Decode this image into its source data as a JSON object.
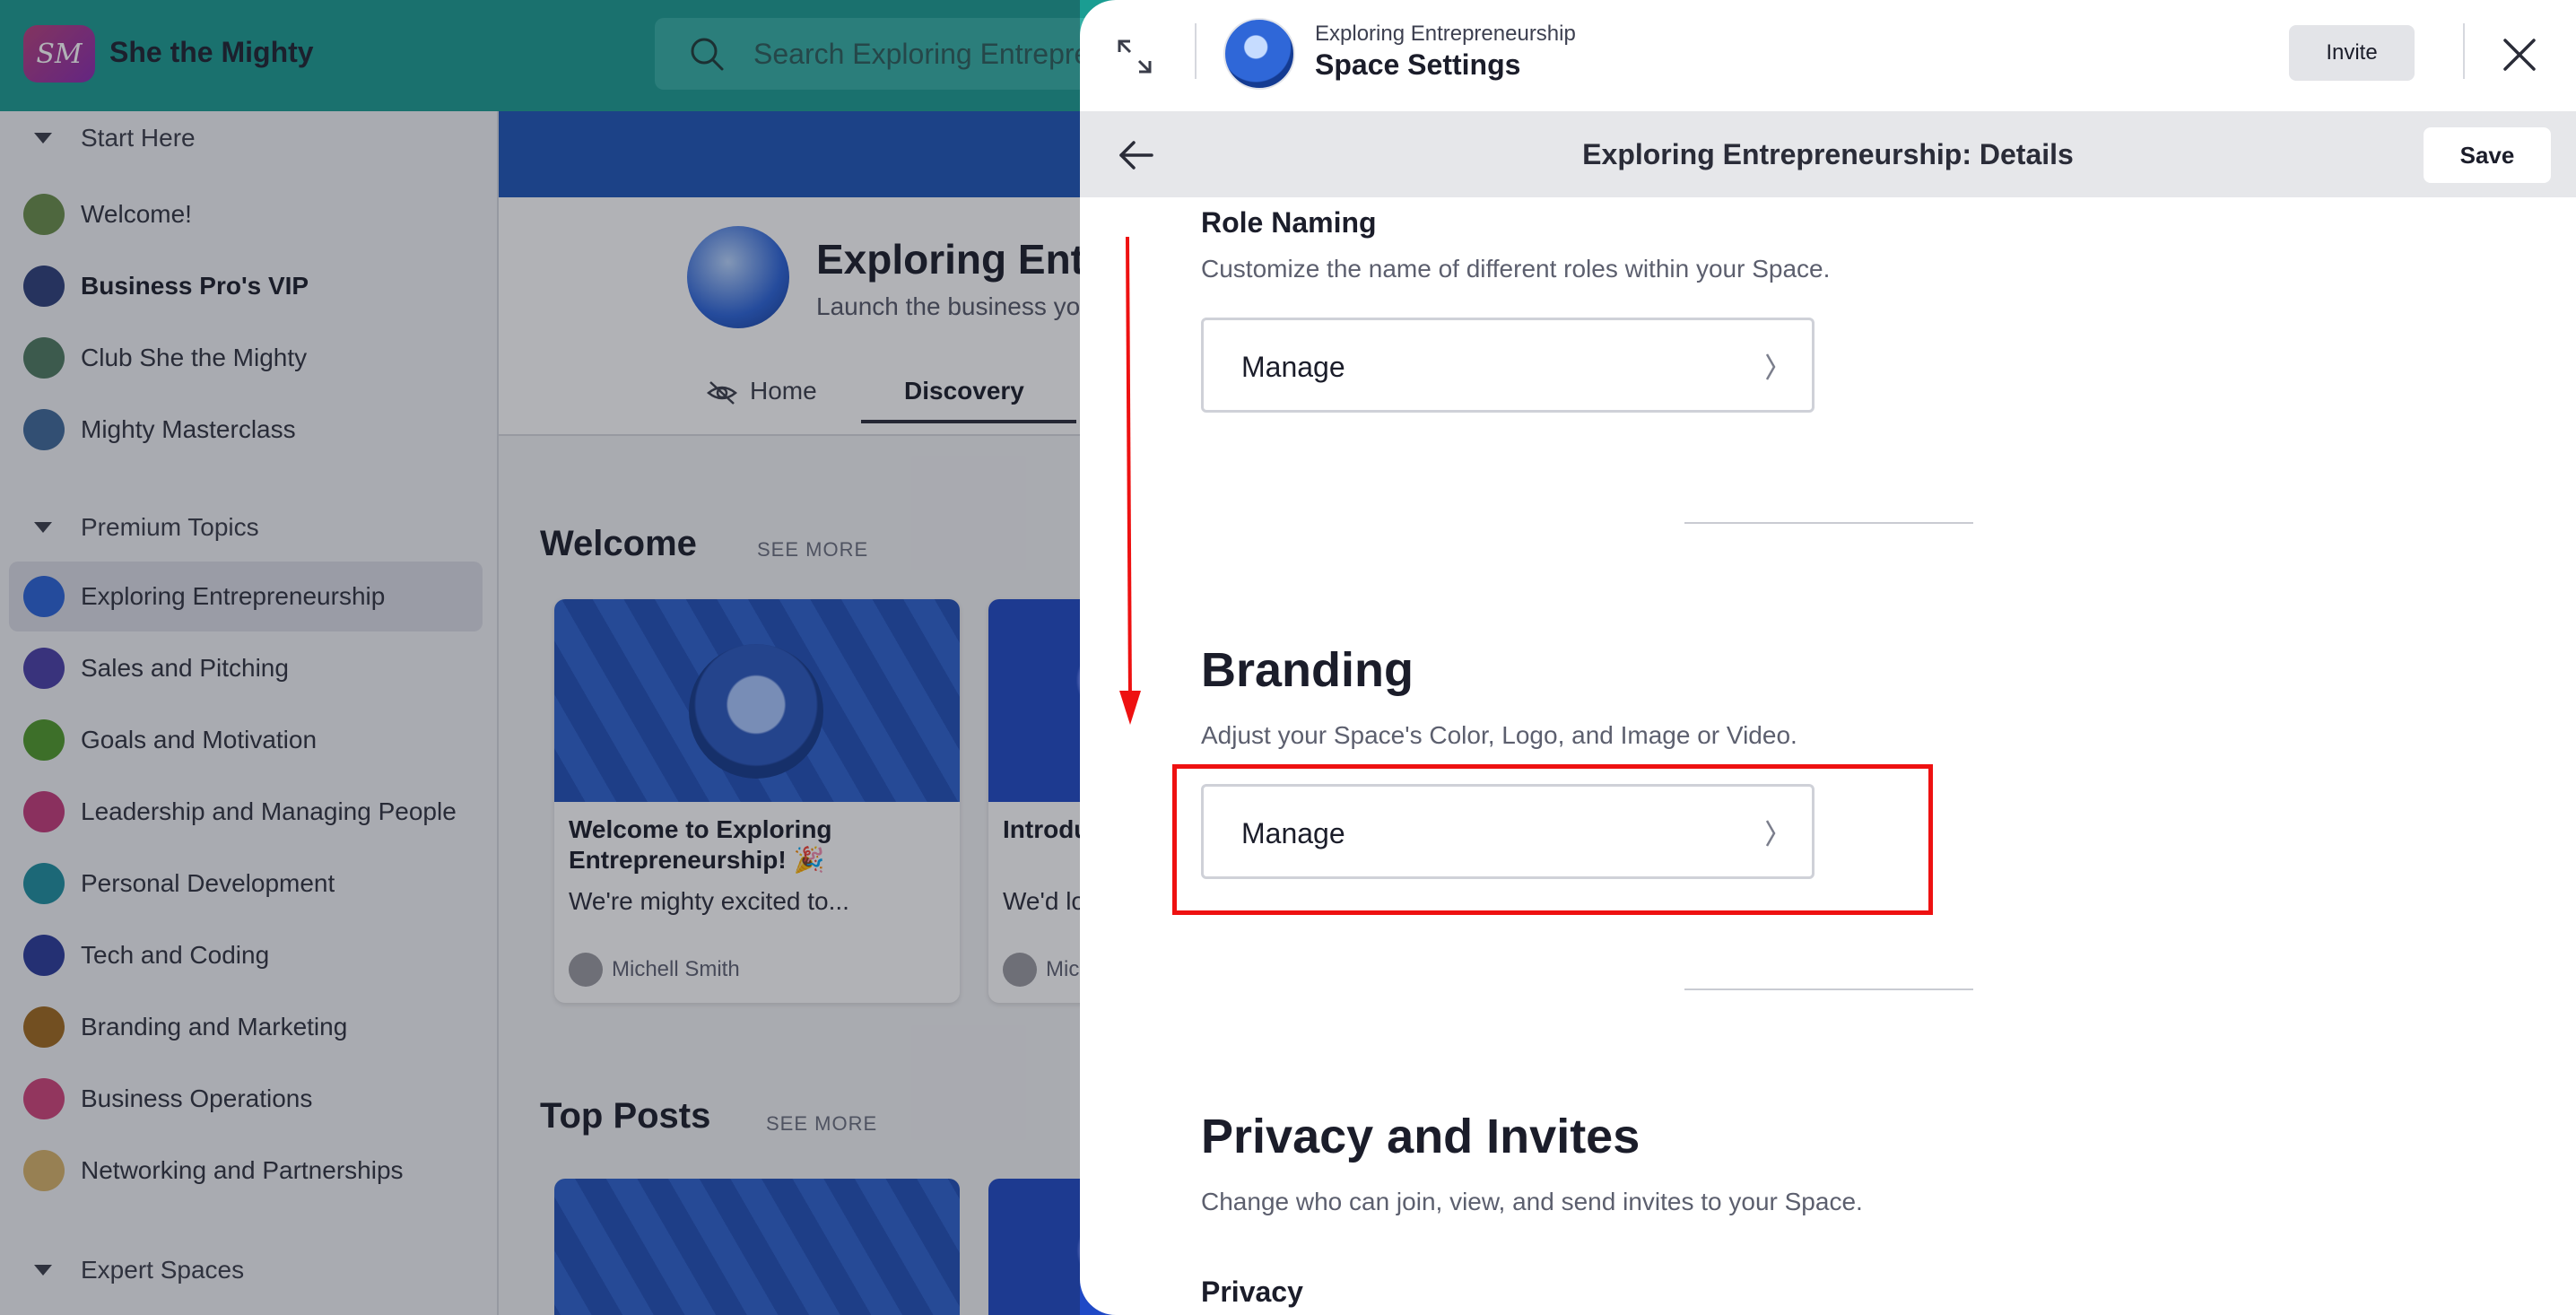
{
  "app": {
    "name": "She the Mighty",
    "logo_text": "SM",
    "search_placeholder": "Search Exploring Entrepre"
  },
  "sidebar": {
    "sections": [
      {
        "label": "Start Here"
      },
      {
        "label": "Premium Topics"
      },
      {
        "label": "Expert Spaces"
      }
    ],
    "items": [
      {
        "label": "Welcome!",
        "color": "#6a8d4a"
      },
      {
        "label": "Business Pro's VIP",
        "color": "#2c3f7a"
      },
      {
        "label": "Club She the Mighty",
        "color": "#4e7a60"
      },
      {
        "label": "Mighty Masterclass",
        "color": "#3f6a9a"
      },
      {
        "label": "Exploring Entrepreneurship",
        "color": "#2a63d8"
      },
      {
        "label": "Sales and Pitching",
        "color": "#4a3fa8"
      },
      {
        "label": "Goals and Motivation",
        "color": "#4f9a2a"
      },
      {
        "label": "Leadership and Managing People",
        "color": "#c43a7a"
      },
      {
        "label": "Personal Development",
        "color": "#1e8fa0"
      },
      {
        "label": "Tech and Coding",
        "color": "#2a3a9a"
      },
      {
        "label": "Branding and Marketing",
        "color": "#a06a1e"
      },
      {
        "label": "Business Operations",
        "color": "#d0447a"
      },
      {
        "label": "Networking and Partnerships",
        "color": "#d8b46a"
      }
    ]
  },
  "space": {
    "title": "Exploring Entr",
    "subtitle": "Launch the business yo",
    "tabs": [
      {
        "label": "Home"
      },
      {
        "label": "Discovery"
      }
    ],
    "welcome_heading": "Welcome",
    "top_posts_heading": "Top Posts",
    "see_more": "SEE MORE",
    "cards": [
      {
        "title": "Welcome to Exploring Entrepreneurship! 🎉",
        "excerpt": "We're mighty excited to...",
        "author": "Michell Smith"
      },
      {
        "title": "Introdu",
        "excerpt": "We'd lo about y",
        "author": "Mic"
      }
    ]
  },
  "modal": {
    "space_name": "Exploring Entrepreneurship",
    "title": "Space Settings",
    "invite_label": "Invite",
    "subheader_title": "Exploring Entrepreneurship: Details",
    "save_label": "Save",
    "role_naming": {
      "title": "Role Naming",
      "description": "Customize the name of different roles within your Space.",
      "button_label": "Manage"
    },
    "branding": {
      "title": "Branding",
      "description": "Adjust your Space's Color, Logo, and Image or Video.",
      "button_label": "Manage"
    },
    "privacy_invites": {
      "title": "Privacy and Invites",
      "description": "Change who can join, view, and send invites to your Space.",
      "privacy_label": "Privacy"
    }
  },
  "annotation": {
    "highlight_color": "#ee1111"
  }
}
